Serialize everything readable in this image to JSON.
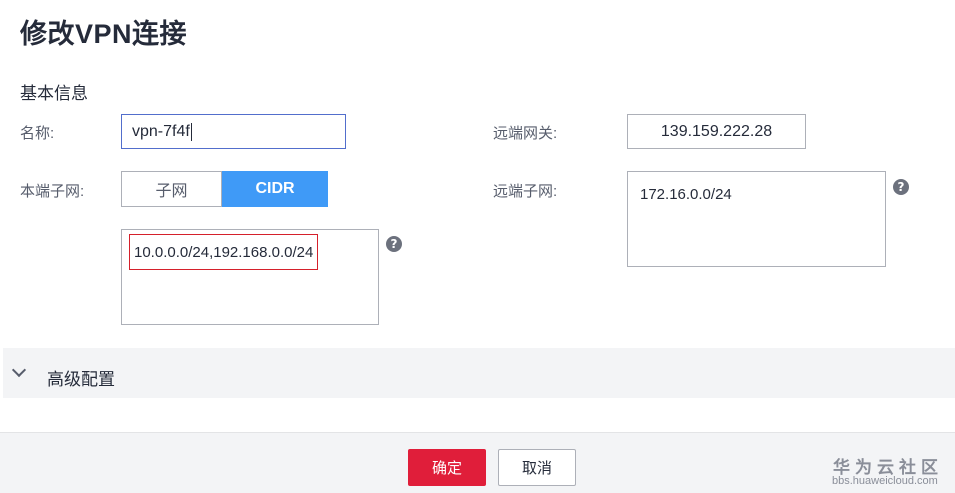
{
  "page": {
    "title": "修改VPN连接"
  },
  "basic": {
    "section_title": "基本信息",
    "name_label": "名称:",
    "name_value": "vpn-7f4f",
    "local_subnet_label": "本端子网:",
    "seg_subnet": "子网",
    "seg_cidr": "CIDR",
    "local_cidr_value": "10.0.0.0/24,192.168.0.0/24",
    "remote_gw_label": "远端网关:",
    "remote_gw_value": "139.159.222.28",
    "remote_subnet_label": "远端子网:",
    "remote_subnet_value": "172.16.0.0/24",
    "help_glyph": "?"
  },
  "advanced": {
    "label": "高级配置",
    "icon": "chevron-down-icon"
  },
  "footer": {
    "confirm": "确定",
    "cancel": "取消"
  },
  "watermark": {
    "title": "华为云社区",
    "url": "bbs.huaweicloud.com"
  },
  "colors": {
    "primary": "#e01e3a",
    "accent": "#3f9af7",
    "highlight": "#d5202b"
  }
}
